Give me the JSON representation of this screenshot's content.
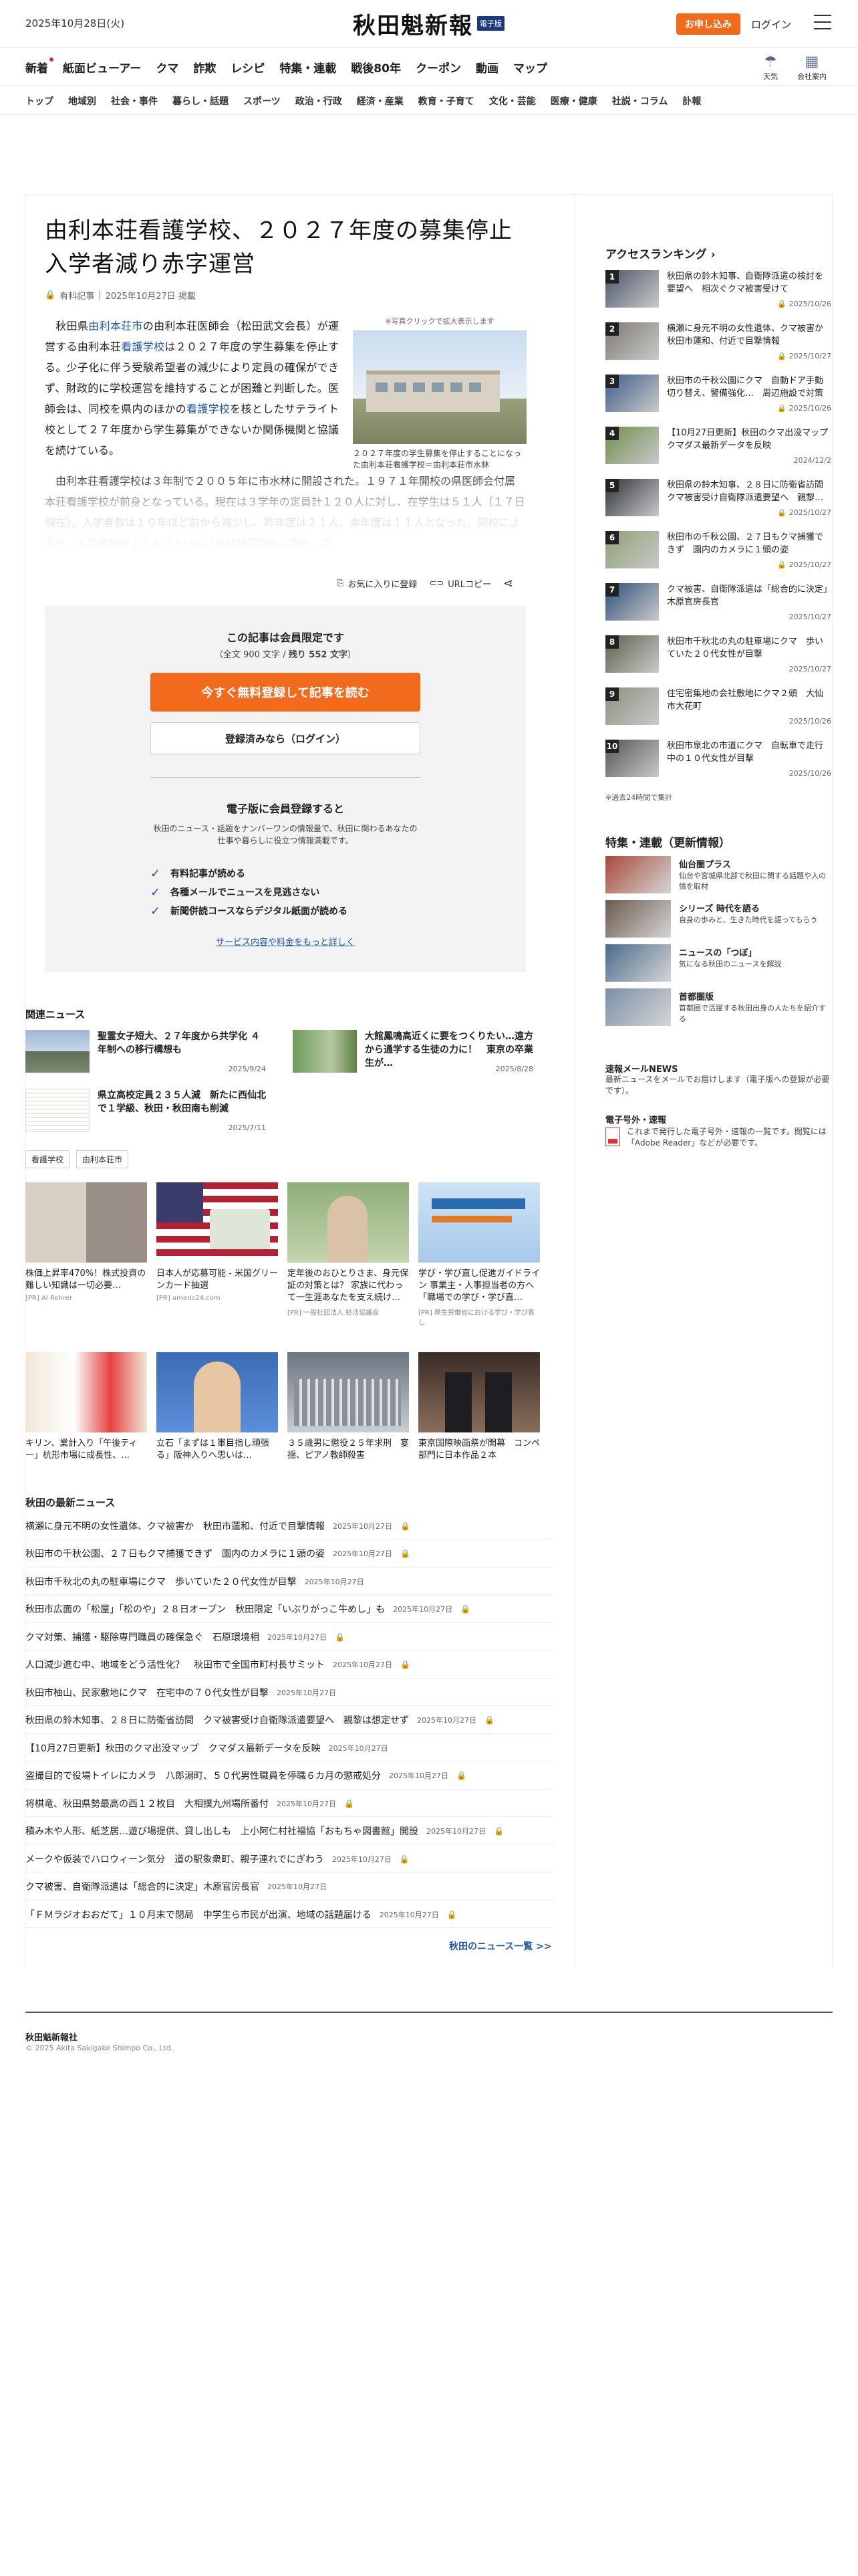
{
  "header": {
    "date": "2025年10月28日(火)",
    "logo_text": "秋田魁新報",
    "logo_badge": "電子版",
    "subscribe_label": "お申し込み",
    "login_label": "ログイン"
  },
  "main_nav": {
    "items": [
      "新着",
      "紙面ビューアー",
      "クマ",
      "詐欺",
      "レシピ",
      "特集・連載",
      "戦後80年",
      "クーポン",
      "動画",
      "マップ"
    ],
    "utility": [
      {
        "label": "天気",
        "icon": "weather-icon"
      },
      {
        "label": "会社案内",
        "icon": "building-icon"
      }
    ]
  },
  "sub_nav": {
    "items": [
      "トップ",
      "地域別",
      "社会・事件",
      "暮らし・話題",
      "スポーツ",
      "政治・行政",
      "経済・産業",
      "教育・子育て",
      "文化・芸能",
      "医療・健康",
      "社説・コラム",
      "訃報"
    ]
  },
  "article": {
    "headline": "由利本荘看護学校、２０２７年度の募集停止 入学者減り赤字運営",
    "badge": "有料記事",
    "published": "2025年10月27日 掲載",
    "lead_parts": [
      {
        "text": "　秋田県",
        "kw": false
      },
      {
        "text": "由利本荘市",
        "kw": true
      },
      {
        "text": "の由利本荘医師会（松田武文会長）が運営する由利本荘",
        "kw": false
      },
      {
        "text": "看護学校",
        "kw": true
      },
      {
        "text": "は２０２７年度の学生募集を停止する。少子化に伴う受験希望者の減少により定員の確保ができず、財政的に学校運営を維持することが困難と判断した。医師会は、同校を県内のほかの",
        "kw": false
      },
      {
        "text": "看護学校",
        "kw": true
      },
      {
        "text": "を核としたサテライト校として２７年度から学生募集ができないか関係機関と協議を続けている。",
        "kw": false
      }
    ],
    "second_parts": [
      {
        "text": "　由利本荘",
        "kw": false
      },
      {
        "text": "看護学校",
        "kw": true
      },
      {
        "text": "は３年制で２００５年に市水林に開設された。１９７１年開校の県医師会付属本荘看護学校が前身となっている。現在は３学年の定員計１２０人に対し、在学生は５１人（１７日現在）。入学者数は１０年ほど前から減少し、昨年度は２１人、本年度は１１人となった。同校によると、入学者数が１５人以上いなければ採算割れに陥り、学",
        "kw": false
      }
    ],
    "photo_caption_top": "※写真クリックで拡大表示します",
    "photo_caption": "２０２７年度の学生募集を停止することになった由利本荘看護学校＝由利本荘市水林",
    "favorite_label": "お気に入りに登録",
    "url_copy_label": "URLコピー"
  },
  "paywall": {
    "title": "この記事は会員限定です",
    "count_prefix": "（全文 900 文字 / ",
    "count_remaining": "残り 552 文字",
    "count_suffix": "）",
    "primary_btn": "今すぐ無料登録して記事を読む",
    "secondary_btn": "登録済みなら（ログイン）",
    "sub_title": "電子版に会員登録すると",
    "description": "秋田のニュース・話題をナンバーワンの情報量で、秋田に関わるあなたの仕事や暮らしに役立つ情報満載です。",
    "benefits": [
      "有料記事が読める",
      "各種メールでニュースを見逃さない",
      "新聞併読コースならデジタル紙面が読める"
    ],
    "more_link": "サービス内容や料金をもっと詳しく"
  },
  "related": {
    "heading": "関連ニュース",
    "items": [
      {
        "title": "聖霊女子短大、２７年度から共学化 ４年制への移行構想も",
        "date": "2025/9/24"
      },
      {
        "title": "大館鳳鳴高近くに要をつくりたい…遠方から通学する生徒の力に！　東京の卒業生が…",
        "date": "2025/8/28"
      },
      {
        "title": "県立高校定員２３５人減　新たに西仙北で１学級、秋田・秋田南も削減",
        "date": "2025/7/11"
      }
    ],
    "tags": [
      "看護学校",
      "由利本荘市"
    ]
  },
  "ads": [
    {
      "title": "株価上昇率470%！株式投資の難しい知識は一切必要…",
      "source": "[PR] AI Rohrer"
    },
    {
      "title": "日本人が応募可能 - 米国グリーンカード抽選",
      "source": "[PR] americ24.com"
    },
    {
      "title": "定年後のおひとりさま、身元保証の対策とは？ 家族に代わって一生涯あなたを支え続ける。入院手…",
      "source": "[PR] 一般社団法人 終活協議会"
    },
    {
      "title": "学び・学び直し促進ガイドライン 事業主・人事担当者の方へ「職場での学び・学び直…",
      "source": "[PR] 厚生労働省における学び・学び直し"
    },
    {
      "title": "キリン、業計入り「午後ティー」杭形市場に成長性、…",
      "source": ""
    },
    {
      "title": "立石「まずは１軍目指し頑張る」阪神入りへ思いは…",
      "source": ""
    },
    {
      "title": "３５歳男に懲役２５年求刑　宴揺、ピアノ教師殺害",
      "source": ""
    },
    {
      "title": "東京国際映画祭が開幕　コンペ部門に日本作品２本",
      "source": ""
    }
  ],
  "latest": {
    "heading": "秋田の最新ニュース",
    "items": [
      {
        "title": "横瀬に身元不明の女性遺体、クマ被害か　秋田市蓮和、付近で目撃情報",
        "date": "2025年10月27日",
        "locked": true
      },
      {
        "title": "秋田市の千秋公園、２７日もクマ捕獲できず　園内のカメラに１頭の姿",
        "date": "2025年10月27日",
        "locked": true
      },
      {
        "title": "秋田市千秋北の丸の駐車場にクマ　歩いていた２０代女性が目撃",
        "date": "2025年10月27日",
        "locked": false
      },
      {
        "title": "秋田市広面の「松屋」「松のや」２８日オープン　秋田限定「いぶりがっこ牛めし」も",
        "date": "2025年10月27日",
        "locked": true
      },
      {
        "title": "クマ対策、捕獲・駆除専門職員の確保急ぐ　石原環境相",
        "date": "2025年10月27日",
        "locked": true
      },
      {
        "title": "人口減少進む中、地域をどう活性化？　秋田市で全国市町村長サミット",
        "date": "2025年10月27日",
        "locked": true
      },
      {
        "title": "秋田市柚山、民家敷地にクマ　在宅中の７０代女性が目撃",
        "date": "2025年10月27日",
        "locked": false
      },
      {
        "title": "秋田県の鈴木知事、２８日に防衛省訪問　クマ被害受け自衛隊派遣要望へ　親黎は想定せず",
        "date": "2025年10月27日",
        "locked": true
      },
      {
        "title": "【10月27日更新】秋田のクマ出没マップ　クマダス最新データを反映",
        "date": "2025年10月27日",
        "locked": false
      },
      {
        "title": "盗撮目的で役場トイレにカメラ　八郎潟町、５０代男性職員を停職６カ月の懲戒処分",
        "date": "2025年10月27日",
        "locked": true
      },
      {
        "title": "将棋竜、秋田県勢最高の西１２枚目　大相撲九州場所番付",
        "date": "2025年10月27日",
        "locked": true
      },
      {
        "title": "積み木や人形、紙芝居…遊び場提供、貸し出しも　上小阿仁村社福協「おもちゃ図書館」開設",
        "date": "2025年10月27日",
        "locked": true
      },
      {
        "title": "メークや仮装でハロウィーン気分　道の駅象衆町、親子連れでにぎわう",
        "date": "2025年10月27日",
        "locked": true
      },
      {
        "title": "クマ被害、自衛隊派遣は「総合的に決定」木原官房長官",
        "date": "2025年10月27日",
        "locked": false
      },
      {
        "title": "「ＦＭラジオおおだて」１０月末で閉局　中学生ら市民が出演、地域の話題届ける",
        "date": "2025年10月27日",
        "locked": true
      }
    ],
    "more": "秋田のニュース一覧 >>"
  },
  "sidebar": {
    "ranking_heading": "アクセスランキング",
    "ranking": [
      {
        "num": "1",
        "title": "秋田県の鈴木知事、自衛隊派遣の検討を要望へ　相次ぐクマ被害受けて",
        "date": "2025/10/26",
        "locked": true
      },
      {
        "num": "2",
        "title": "横瀬に身元不明の女性遺体、クマ被害か　秋田市蓮和、付近で目撃情報",
        "date": "2025/10/27",
        "locked": true
      },
      {
        "num": "3",
        "title": "秋田市の千秋公園にクマ　自動ドア手動切り替え、警備強化…　周辺施設で対策",
        "date": "2025/10/26",
        "locked": true
      },
      {
        "num": "4",
        "title": "【10月27日更新】秋田のクマ出没マップ　クマダス最新データを反映",
        "date": "2024/12/2",
        "locked": false
      },
      {
        "num": "5",
        "title": "秋田県の鈴木知事、２８日に防衛省訪問　クマ被害受け自衛隊派遣要望へ　親黎は想…",
        "date": "2025/10/27",
        "locked": true
      },
      {
        "num": "6",
        "title": "秋田市の千秋公園、２７日もクマ捕獲できず　園内のカメラに１頭の姿",
        "date": "2025/10/27",
        "locked": true
      },
      {
        "num": "7",
        "title": "クマ被害、自衛隊派遣は「総合的に決定」木原官房長官",
        "date": "2025/10/27",
        "locked": false
      },
      {
        "num": "8",
        "title": "秋田市千秋北の丸の駐車場にクマ　歩いていた２０代女性が目撃",
        "date": "2025/10/27",
        "locked": false
      },
      {
        "num": "9",
        "title": "住宅密集地の会社敷地にクマ２頭　大仙市大花町",
        "date": "2025/10/26",
        "locked": false
      },
      {
        "num": "10",
        "title": "秋田市泉北の市道にクマ　自転車で走行中の１０代女性が目撃",
        "date": "2025/10/26",
        "locked": false
      }
    ],
    "ranking_note": "※過去24時間で集計",
    "features_heading": "特集・連載（更新情報）",
    "features": [
      {
        "title": "仙台圏プラス",
        "desc": "仙台や宮城県北部で秋田に関する話題や人の情を取材"
      },
      {
        "title": "シリーズ 時代を語る",
        "desc": "自身の歩みと、生きた時代を語ってもらう"
      },
      {
        "title": "ニュースの「つぼ」",
        "desc": "気になる秋田のニュースを解説"
      },
      {
        "title": "首都圏版",
        "desc": "首都圏で活躍する秋田出身の人たちを紹介する"
      }
    ],
    "mail_heading": "速報メールNEWS",
    "mail_desc": "最新ニュースをメールでお届けします（電子版への登録が必要です）。",
    "ext_heading": "電子号外・速報",
    "ext_desc": "これまで発行した電子号外・速報の一覧です。閲覧には「Adobe Reader」などが必要です。"
  },
  "footer": {
    "company": "秋田魁新報社",
    "copyright": "© 2025 Akita Sakigake Shimpo Co., Ltd."
  },
  "colors": {
    "accent": "#f26b1d",
    "link": "#1d57a8",
    "lock": "#e9a51c"
  }
}
